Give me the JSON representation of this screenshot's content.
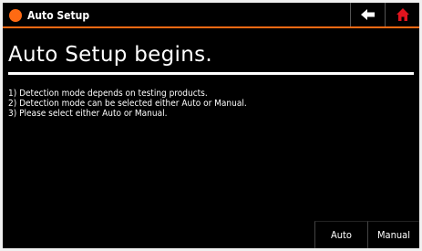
{
  "titlebar": {
    "title": "Auto Setup",
    "accent_color": "#ff6a13",
    "back_icon": "back-arrow-icon",
    "home_icon": "home-icon",
    "home_icon_color": "#e0141e"
  },
  "main": {
    "heading": "Auto Setup begins.",
    "lines": [
      "1) Detection mode depends on testing products.",
      "2) Detection mode can be selected either Auto or Manual.",
      "3) Please select either Auto or Manual."
    ]
  },
  "actions": {
    "auto_label": "Auto",
    "manual_label": "Manual"
  }
}
